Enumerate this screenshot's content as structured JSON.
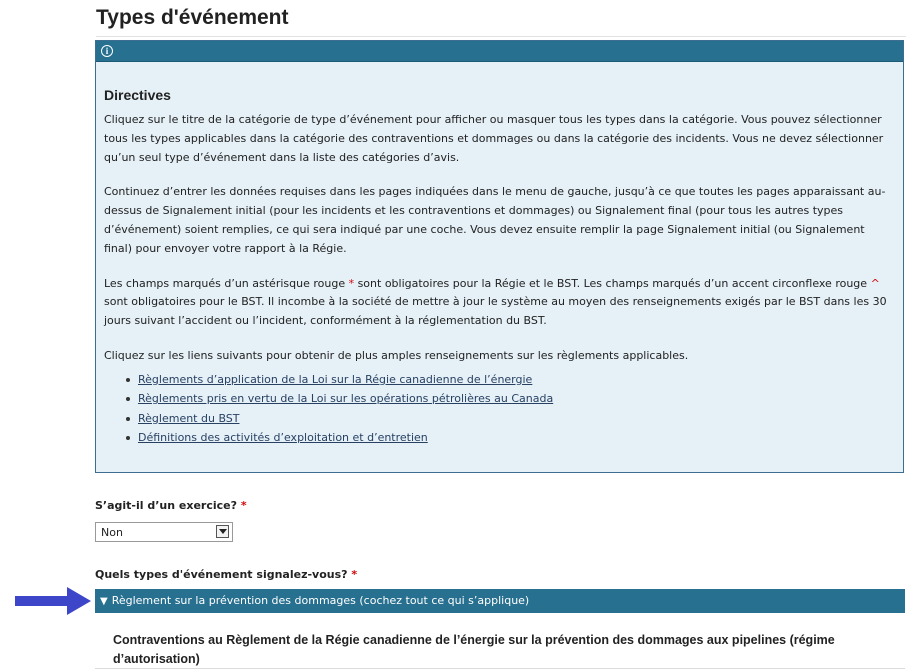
{
  "page": {
    "title": "Types d'événement"
  },
  "directives": {
    "title": "Directives",
    "paragraphs": [
      "Cliquez sur le titre de la catégorie de type d’événement pour afficher ou masquer tous les types dans la catégorie. Vous pouvez sélectionner tous les types applicables dans la catégorie des contraventions et dommages ou dans la catégorie des incidents. Vous ne devez sélectionner qu’un seul type d’événement dans la liste des catégories d’avis.",
      "Continuez d’entrer les données requises dans les pages indiquées dans le menu de gauche, jusqu’à ce que toutes les pages apparaissant au-dessus de Signalement initial (pour les incidents et les contraventions et dommages) ou Signalement final (pour tous les autres types d’événement) soient remplies, ce qui sera indiqué par une coche. Vous devez ensuite remplir la page Signalement initial (ou Signalement final) pour envoyer votre rapport à la Régie."
    ],
    "para3_a": "Les champs marqués d’un astérisque rouge ",
    "star": "*",
    "para3_b": " sont obligatoires pour la Régie et le BST. Les champs marqués d’un accent circonflexe rouge ",
    "caret": "^",
    "para3_c": " sont obligatoires pour le BST. Il incombe à la société de mettre à jour le système au moyen des renseignements exigés par le BST dans les 30 jours suivant l’accident ou l’incident, conformément à la réglementation du BST.",
    "para4": "Cliquez sur les liens suivants pour obtenir de plus amples renseignements sur les règlements applicables.",
    "links": [
      "Règlements d’application de la Loi sur la Régie canadienne de l’énergie",
      "Règlements pris en vertu de la Loi sur les opérations pétrolières au Canada",
      "Règlement du BST",
      "Définitions des activités d’exploitation et d’entretien"
    ]
  },
  "exercise": {
    "label": "S’agit-il d’un exercice?",
    "required_marker": "*",
    "selected_value": "Non"
  },
  "event_types": {
    "label": "Quels types d'événement signalez-vous?",
    "required_marker": "*",
    "category_header": "Règlement sur la prévention des dommages (cochez tout ce qui s’applique)",
    "subheading": "Contraventions au Règlement de la Régie canadienne de l’énergie sur la prévention des dommages aux pipelines (régime d’autorisation)"
  },
  "colors": {
    "header_bar": "#27708f",
    "panel_bg": "#e5f0f7",
    "link": "#284162",
    "required": "#d3080c",
    "arrow": "#3d46c9"
  }
}
